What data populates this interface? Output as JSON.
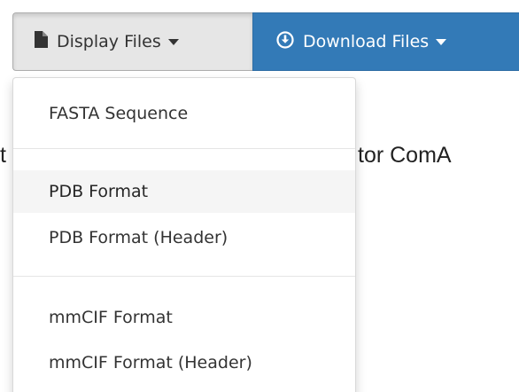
{
  "background_title": {
    "left_fragment": "t",
    "right_fragment": "tor ComA"
  },
  "toolbar": {
    "display_label": "Display Files",
    "display_icon": "file-icon",
    "download_label": "Download Files",
    "download_icon": "download-circle-icon",
    "download_color": "#337ab7"
  },
  "display_menu": {
    "items": [
      {
        "label": "FASTA Sequence"
      },
      {
        "label": "PDB Format",
        "highlighted": true
      },
      {
        "label": "PDB Format (Header)"
      },
      {
        "label": "mmCIF Format"
      },
      {
        "label": "mmCIF Format (Header)"
      }
    ]
  }
}
